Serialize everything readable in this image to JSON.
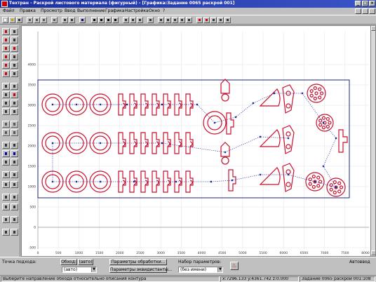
{
  "window": {
    "title": "Техтран - Раскрой листового материала (фигурный) - [Графика:Задание 0065 раскрой 001]",
    "min": "_",
    "max": "□",
    "close": "×"
  },
  "menu": [
    "Файл",
    "Правка",
    "Просмотр",
    "Ввод",
    "Выполнение",
    "Графика",
    "Настройка",
    "Окно",
    "?"
  ],
  "ruler": {
    "x_ticks": [
      "0",
      "500",
      "1000",
      "1500",
      "2000",
      "2500",
      "3000",
      "3500",
      "4000",
      "4500",
      "5000",
      "5500",
      "6000",
      "6500",
      "7000",
      "7500",
      "8000"
    ],
    "y_ticks": [
      "4000",
      "3500",
      "3000",
      "2500",
      "2000",
      "1500",
      "1000",
      "500",
      "0",
      "-500",
      "-1000",
      "-1500"
    ]
  },
  "panel": {
    "approach_label": "Точка подхода:",
    "bypass_button": "Обход:",
    "auto_button": "(авто)",
    "bypass_value": "(авто)",
    "proc_params_button": "Параметры обработки...",
    "equidistant_params_button": "Параметры эквидистанты...",
    "param_set_label": "Набор параметров:",
    "param_set_value": "(без имени)",
    "autoinput_label": "Автоввод"
  },
  "status": {
    "hint": "Выберите направление обхода относительно описания контура",
    "coords": "x:7296.133 y:4361.742 z:0.000",
    "task": "Задание 0065 раскрой 001:108"
  },
  "colors": {
    "title_bg": "#1c2f9e",
    "part_stroke": "#c8102e",
    "sheet_stroke": "#1a237e",
    "path_dots": "#1a2a9a"
  }
}
